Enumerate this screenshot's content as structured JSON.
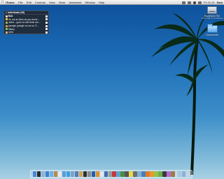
{
  "menubar": {
    "apple_icon": "apple-icon",
    "app_name": "iTunes",
    "menus": [
      "File",
      "Edit",
      "Controls",
      "View",
      "Store",
      "Advanced",
      "Window",
      "Help"
    ],
    "clock": "Fri 11:13",
    "user": "Sam"
  },
  "desktop": {
    "icons": [
      {
        "label": "Macintosh HD",
        "sublabel": "74.53 GB, 5.13 GB free",
        "icon": "hard-drive-icon"
      },
      {
        "label": "Documents",
        "icon": "folder-icon"
      }
    ]
  },
  "panel": {
    "title": "Individuals (39)",
    "rows": [
      {
        "text": "Bob",
        "bold": true,
        "icon_color": "#d9d9d9"
      },
      {
        "text": "it's not as think as you drunk…",
        "bold": false,
        "icon_color": "#e8c93a"
      },
      {
        "text": "Jdeel – gone so wet think are…",
        "bold": false,
        "icon_color": "#9ab06b"
      },
      {
        "text": "greegle greegle on we so Ti…",
        "bold": false,
        "icon_color": "#d7a03a"
      },
      {
        "text": "Mikey",
        "bold": false,
        "icon_color": "#7cc36a"
      },
      {
        "text": "chris",
        "bold": false,
        "icon_color": "#c9b27a"
      }
    ]
  },
  "dock": {
    "apps": [
      {
        "name": "finder",
        "color": "#4a86d6"
      },
      {
        "name": "dashboard",
        "color": "#2a2a2a"
      },
      {
        "name": "mail",
        "color": "#8fb3d9"
      },
      {
        "name": "safari",
        "color": "#3d7fd0"
      },
      {
        "name": "ichat",
        "color": "#6cb0e6"
      },
      {
        "name": "address-book",
        "color": "#b88a4a"
      },
      {
        "name": "ical",
        "color": "#e8e8e8"
      },
      {
        "name": "preview",
        "color": "#5c9bd6"
      },
      {
        "name": "itunes",
        "color": "#3aa0e0"
      },
      {
        "name": "iphoto",
        "color": "#7aa3c8"
      },
      {
        "name": "imovie",
        "color": "#5a78b8"
      },
      {
        "name": "garageband",
        "color": "#d0a44a"
      },
      {
        "name": "terminal",
        "color": "#303030"
      },
      {
        "name": "system-preferences",
        "color": "#8a8a8a"
      },
      {
        "name": "photoshop",
        "color": "#2b5aa8"
      },
      {
        "name": "illustrator",
        "color": "#e0902a"
      },
      {
        "name": "textedit",
        "color": "#e6e6e6"
      },
      {
        "name": "quicktime",
        "color": "#3f6fb0"
      },
      {
        "name": "dvd-player",
        "color": "#9a9a9a"
      },
      {
        "name": "app-store-app",
        "color": "#c43a3a"
      },
      {
        "name": "network-utility",
        "color": "#5fa0d8"
      },
      {
        "name": "activity-monitor",
        "color": "#4b8f3a"
      },
      {
        "name": "calculator",
        "color": "#555555"
      },
      {
        "name": "stickies",
        "color": "#e8d84a"
      },
      {
        "name": "font-book",
        "color": "#6e6e6e"
      },
      {
        "name": "image-capture",
        "color": "#7fb0d8"
      },
      {
        "name": "xcode",
        "color": "#4a7fb8"
      },
      {
        "name": "firefox",
        "color": "#e07a2a"
      },
      {
        "name": "vlc",
        "color": "#e89a2a"
      },
      {
        "name": "omniweb",
        "color": "#9ac04a"
      },
      {
        "name": "adium",
        "color": "#6ab04a"
      },
      {
        "name": "chess",
        "color": "#3a3a3a"
      },
      {
        "name": "grapher",
        "color": "#b86ad0"
      },
      {
        "name": "sherlock",
        "color": "#a07a4a"
      }
    ],
    "right": [
      {
        "name": "downloads-folder",
        "color": "#aac7e2"
      },
      {
        "name": "applications-folder",
        "color": "#8cb1d8"
      },
      {
        "name": "trash",
        "color": "#c9d3dd"
      }
    ]
  }
}
